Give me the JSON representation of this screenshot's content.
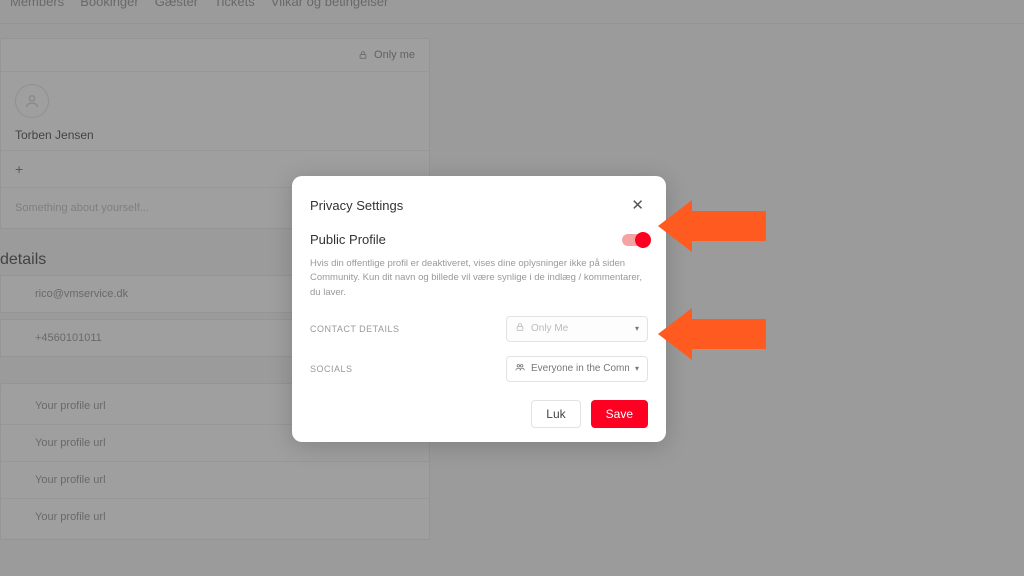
{
  "tabs": [
    "Members",
    "Bookinger",
    "Gæster",
    "Tickets",
    "Vilkår og betingelser"
  ],
  "profile": {
    "only_me": "Only me",
    "name": "Torben Jensen",
    "plus": "+",
    "about_placeholder": "Something about yourself..."
  },
  "details": {
    "heading": "details",
    "email": "rico@vmservice.dk",
    "phone": "+4560101011"
  },
  "urls": {
    "u1": "Your profile url",
    "u2": "Your profile url",
    "u3": "Your profile url",
    "u4": "Your profile url"
  },
  "modal": {
    "title": "Privacy Settings",
    "close": "✕",
    "public_profile": "Public Profile",
    "help": "Hvis din offentlige profil er deaktiveret, vises dine oplysninger ikke på siden Community. Kun dit navn og billede vil være synlige i de indlæg / kommentarer, du laver.",
    "contact_details_label": "CONTACT DETAILS",
    "contact_details_value": "Only Me",
    "socials_label": "SOCIALS",
    "socials_value": "Everyone in the Community",
    "cancel": "Luk",
    "save": "Save"
  }
}
